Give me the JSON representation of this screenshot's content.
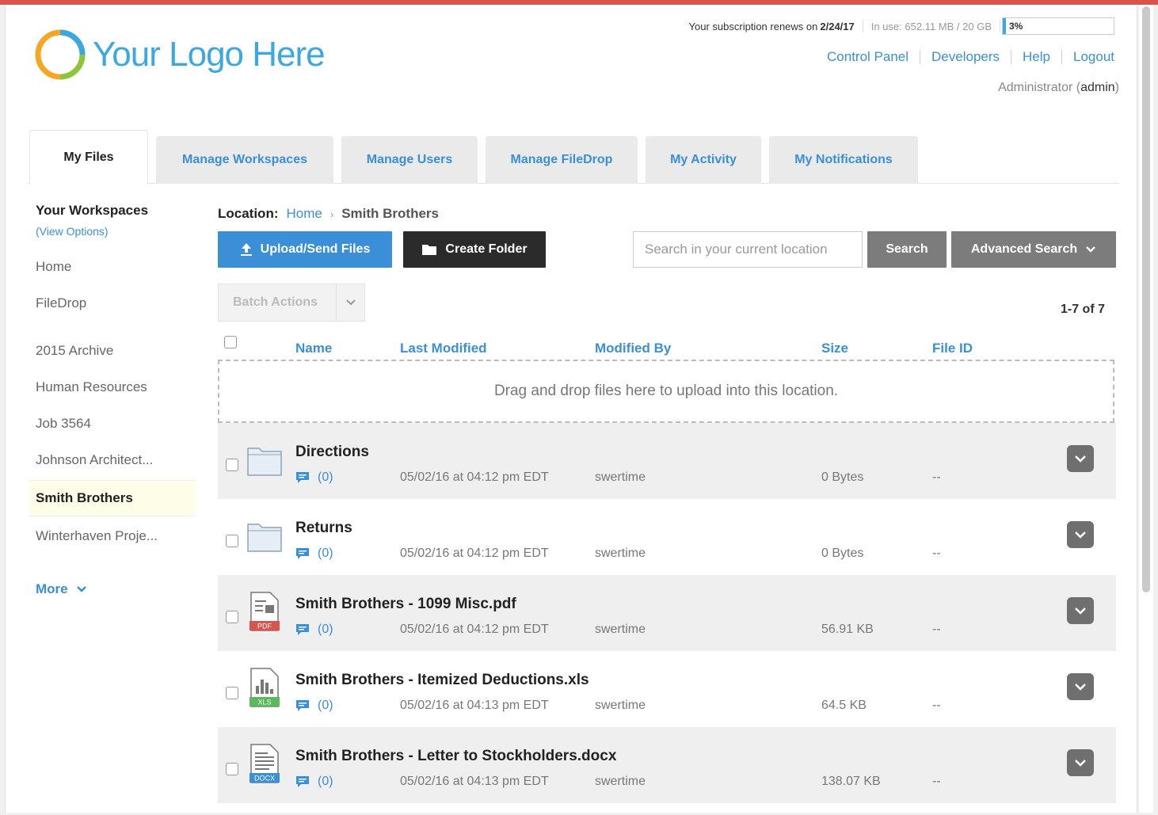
{
  "header": {
    "logo_text": "Your Logo Here",
    "subscription_prefix": "Your subscription renews on ",
    "subscription_date": "2/24/17",
    "usage_text": "In use: 652.11 MB / 20 GB",
    "usage_percent": "3%",
    "usage_fraction": 0.03,
    "links": [
      "Control Panel",
      "Developers",
      "Help",
      "Logout"
    ],
    "user_role": "Administrator (",
    "user_name": "admin",
    "user_suffix": ")"
  },
  "tabs": [
    "My Files",
    "Manage Workspaces",
    "Manage Users",
    "Manage FileDrop",
    "My Activity",
    "My Notifications"
  ],
  "sidebar": {
    "title": "Your Workspaces",
    "view_options": "(View Options)",
    "items": [
      "Home",
      "FileDrop",
      "2015 Archive",
      "Human Resources",
      "Job 3564",
      "Johnson Architect...",
      "Smith Brothers",
      "Winterhaven Proje..."
    ],
    "active": "Smith Brothers",
    "more_label": "More"
  },
  "location": {
    "label": "Location:",
    "home": "Home",
    "separator": "›",
    "current": "Smith Brothers"
  },
  "toolbar": {
    "upload_label": "Upload/Send Files",
    "create_folder_label": "Create Folder",
    "search_placeholder": "Search in your current location",
    "search_label": "Search",
    "advanced_search_label": "Advanced Search",
    "batch_actions_label": "Batch Actions",
    "count_label": "1-7 of 7"
  },
  "columns": [
    "Name",
    "Last Modified",
    "Modified By",
    "Size",
    "File ID"
  ],
  "dropzone_text": "Drag and drop files here to upload into this location.",
  "files": [
    {
      "name": "Directions",
      "type": "folder",
      "comments": "(0)",
      "modified": "05/02/16 at 04:12 pm EDT",
      "by": "swertime",
      "size": "0 Bytes",
      "file_id": "--"
    },
    {
      "name": "Returns",
      "type": "folder",
      "comments": "(0)",
      "modified": "05/02/16 at 04:12 pm EDT",
      "by": "swertime",
      "size": "0 Bytes",
      "file_id": "--"
    },
    {
      "name": "Smith Brothers - 1099 Misc.pdf",
      "type": "PDF",
      "comments": "(0)",
      "modified": "05/02/16 at 04:12 pm EDT",
      "by": "swertime",
      "size": "56.91 KB",
      "file_id": "--"
    },
    {
      "name": "Smith Brothers - Itemized Deductions.xls",
      "type": "XLS",
      "comments": "(0)",
      "modified": "05/02/16 at 04:13 pm EDT",
      "by": "swertime",
      "size": "64.5 KB",
      "file_id": "--"
    },
    {
      "name": "Smith Brothers - Letter to Stockholders.docx",
      "type": "DOCX",
      "comments": "(0)",
      "modified": "05/02/16 at 04:13 pm EDT",
      "by": "swertime",
      "size": "138.07 KB",
      "file_id": "--"
    }
  ],
  "colors": {
    "accent": "#3a8fd6",
    "dark_button": "#2b2b2b",
    "gray_button": "#7c7c7c",
    "top_bar": "#d9534f",
    "pdf_badge": "#d9534f",
    "xls_badge": "#5cb85c",
    "docx_badge": "#3a8fd6"
  }
}
